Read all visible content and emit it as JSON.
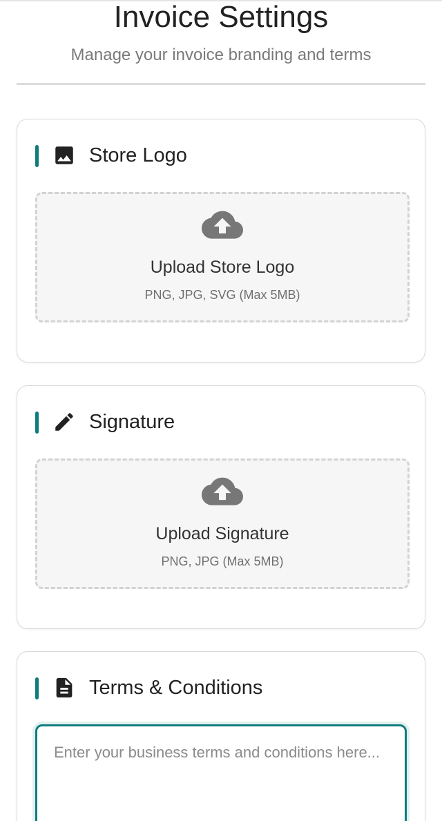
{
  "header": {
    "title": "Invoice Settings",
    "subtitle": "Manage your invoice branding and terms"
  },
  "theme": {
    "accent": "#0f7c7c",
    "icon_color": "#222222",
    "upload_icon_color": "#777777"
  },
  "sections": {
    "store_logo": {
      "title": "Store Logo",
      "icon": "image-icon",
      "upload_label": "Upload Store Logo",
      "upload_hint": "PNG, JPG, SVG (Max 5MB)",
      "upload_icon": "cloud-upload-icon"
    },
    "signature": {
      "title": "Signature",
      "icon": "pencil-icon",
      "upload_label": "Upload Signature",
      "upload_hint": "PNG, JPG (Max 5MB)",
      "upload_icon": "cloud-upload-icon"
    },
    "terms": {
      "title": "Terms & Conditions",
      "icon": "document-icon",
      "value": "",
      "placeholder": "Enter your business terms and conditions here..."
    }
  }
}
